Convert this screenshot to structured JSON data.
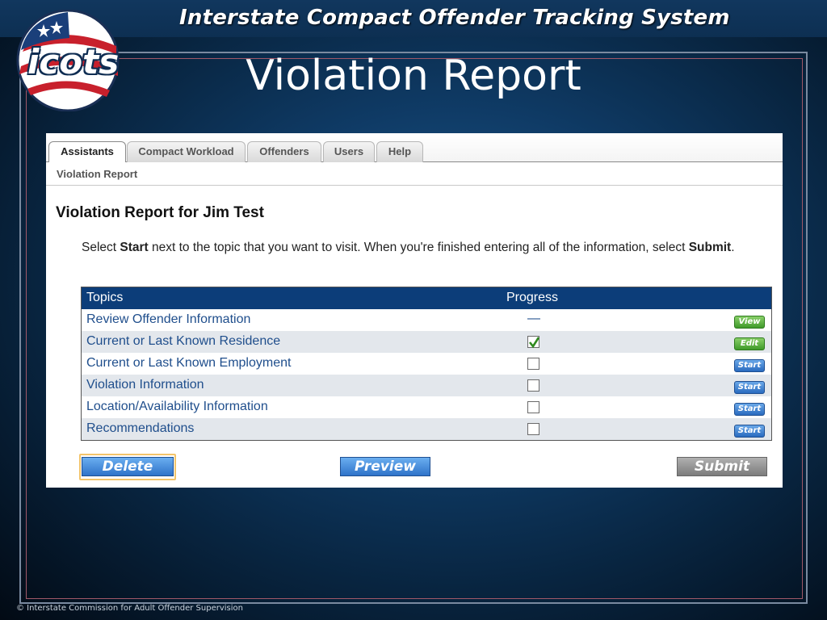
{
  "banner": {
    "title": "Interstate Compact Offender Tracking System"
  },
  "logo": {
    "text": "icots"
  },
  "slide": {
    "title": "Violation Report"
  },
  "tabs": [
    {
      "label": "Assistants",
      "active": true
    },
    {
      "label": "Compact Workload",
      "active": false
    },
    {
      "label": "Offenders",
      "active": false
    },
    {
      "label": "Users",
      "active": false
    },
    {
      "label": "Help",
      "active": false
    }
  ],
  "breadcrumb": "Violation Report",
  "report": {
    "title": "Violation Report for Jim Test",
    "instr_1": "Select ",
    "instr_bold_1": "Start",
    "instr_2": " next to the topic that you want to visit. When you're finished entering all of the information, select ",
    "instr_bold_2": "Submit",
    "instr_3": "."
  },
  "table": {
    "headers": {
      "topics": "Topics",
      "progress": "Progress"
    },
    "rows": [
      {
        "topic": "Review Offender Information",
        "progress": "—",
        "action": "View"
      },
      {
        "topic": "Current or Last Known Residence",
        "progress": "checked",
        "action": "Edit"
      },
      {
        "topic": "Current or Last Known Employment",
        "progress": "unchecked",
        "action": "Start"
      },
      {
        "topic": "Violation Information",
        "progress": "unchecked",
        "action": "Start"
      },
      {
        "topic": "Location/Availability Information",
        "progress": "unchecked",
        "action": "Start"
      },
      {
        "topic": "Recommendations",
        "progress": "unchecked",
        "action": "Start"
      }
    ]
  },
  "buttons": {
    "delete": "Delete",
    "preview": "Preview",
    "submit": "Submit"
  },
  "footer": "© Interstate Commission for Adult Offender Supervision",
  "colors": {
    "nav_blue": "#0c3d79",
    "action_green": "#3f9a2a",
    "action_blue": "#2a6bbf"
  }
}
